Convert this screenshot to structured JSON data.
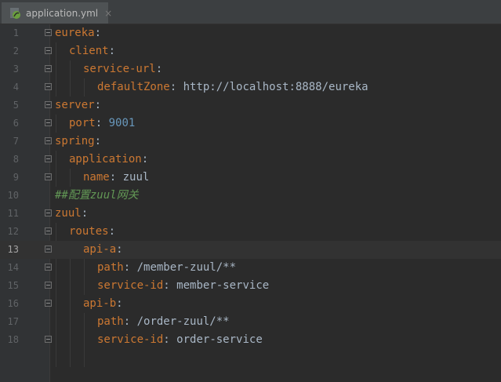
{
  "tab": {
    "filename": "application.yml",
    "close_glyph": "×"
  },
  "lines": [
    {
      "num": "1",
      "key": "eureka",
      "colon": ":"
    },
    {
      "num": "2",
      "key": "client",
      "colon": ":"
    },
    {
      "num": "3",
      "key": "service-url",
      "colon": ":"
    },
    {
      "num": "4",
      "key": "defaultZone",
      "colon": ":",
      "value": "http://localhost:8888/eureka"
    },
    {
      "num": "5",
      "key": "server",
      "colon": ":"
    },
    {
      "num": "6",
      "key": "port",
      "colon": ":",
      "number": "9001"
    },
    {
      "num": "7",
      "key": "spring",
      "colon": ":"
    },
    {
      "num": "8",
      "key": "application",
      "colon": ":"
    },
    {
      "num": "9",
      "key": "name",
      "colon": ":",
      "value": "zuul"
    },
    {
      "num": "10",
      "comment": "##配置zuul网关"
    },
    {
      "num": "11",
      "key": "zuul",
      "colon": ":"
    },
    {
      "num": "12",
      "key": "routes",
      "colon": ":"
    },
    {
      "num": "13",
      "key": "api-a",
      "colon": ":"
    },
    {
      "num": "14",
      "key": "path",
      "colon": ":",
      "value": "/member-zuul/**"
    },
    {
      "num": "15",
      "key": "service-id",
      "colon": ":",
      "value": "member-service"
    },
    {
      "num": "16",
      "key": "api-b",
      "colon": ":"
    },
    {
      "num": "17",
      "key": "path",
      "colon": ":",
      "value": "/order-zuul/**"
    },
    {
      "num": "18",
      "key": "service-id",
      "colon": ":",
      "value": "order-service"
    }
  ]
}
